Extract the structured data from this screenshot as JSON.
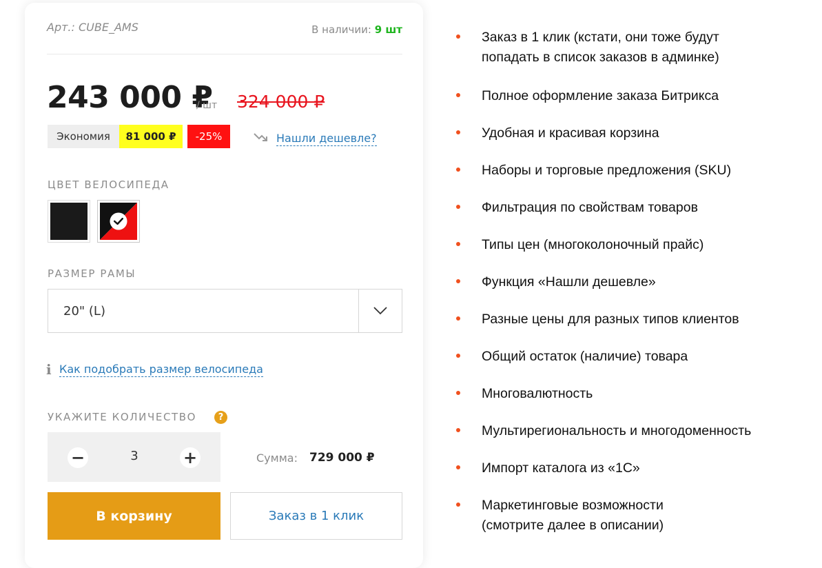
{
  "product": {
    "article": "Арт.: CUBE_AMS",
    "stock_label": "В наличии:",
    "stock_value": "9 шт",
    "price": "243 000 ₽",
    "unit": "/ шт",
    "old_price": "324 000 ₽",
    "economy_label": "Экономия",
    "economy_value": "81 000 ₽",
    "discount": "-25%",
    "cheaper_link": "Нашли дешевле?"
  },
  "color": {
    "label": "ЦВЕТ ВЕЛОСИПЕДА",
    "swatches": [
      {
        "name": "black",
        "selected": false,
        "colors": [
          "#1a1a1a"
        ]
      },
      {
        "name": "black-red",
        "selected": true,
        "colors": [
          "#111111",
          "#ee1111"
        ]
      }
    ]
  },
  "size": {
    "label": "РАЗМЕР РАМЫ",
    "selected": "20\" (L)",
    "help_link": "Как подобрать размер велосипеда"
  },
  "quantity": {
    "label": "УКАЖИТЕ КОЛИЧЕСТВО",
    "help_icon": "?",
    "minus": "−",
    "plus": "+",
    "value": "3",
    "sum_label": "Сумма:",
    "sum_value": "729 000 ₽"
  },
  "buttons": {
    "cart": "В корзину",
    "one_click": "Заказ в 1 клик"
  },
  "features": [
    [
      "Заказ в 1 клик (кстати, они тоже будут",
      "попадать в список заказов в админке)"
    ],
    [
      "Полное оформление заказа Битрикса"
    ],
    [
      "Удобная и красивая корзина"
    ],
    [
      "Наборы и торговые предложения (SKU)"
    ],
    [
      "Фильтрация по свойствам товаров"
    ],
    [
      "Типы цен (многоколоночный прайс)"
    ],
    [
      "Функция «Нашли дешевле»"
    ],
    [
      "Разные цены для разных типов клиентов"
    ],
    [
      "Общий остаток (наличие) товара"
    ],
    [
      "Многовалютность"
    ],
    [
      "Мультирегиональность и многодоменность"
    ],
    [
      "Импорт каталога из «1С»"
    ],
    [
      "Маркетинговые возможности",
      "(смотрите далее в описании)"
    ]
  ],
  "colors": {
    "accent": "#e59c16",
    "link": "#2a7ab8",
    "stock": "#1fb51f",
    "old_price": "#e8141e",
    "bullet": "#f0501e"
  }
}
